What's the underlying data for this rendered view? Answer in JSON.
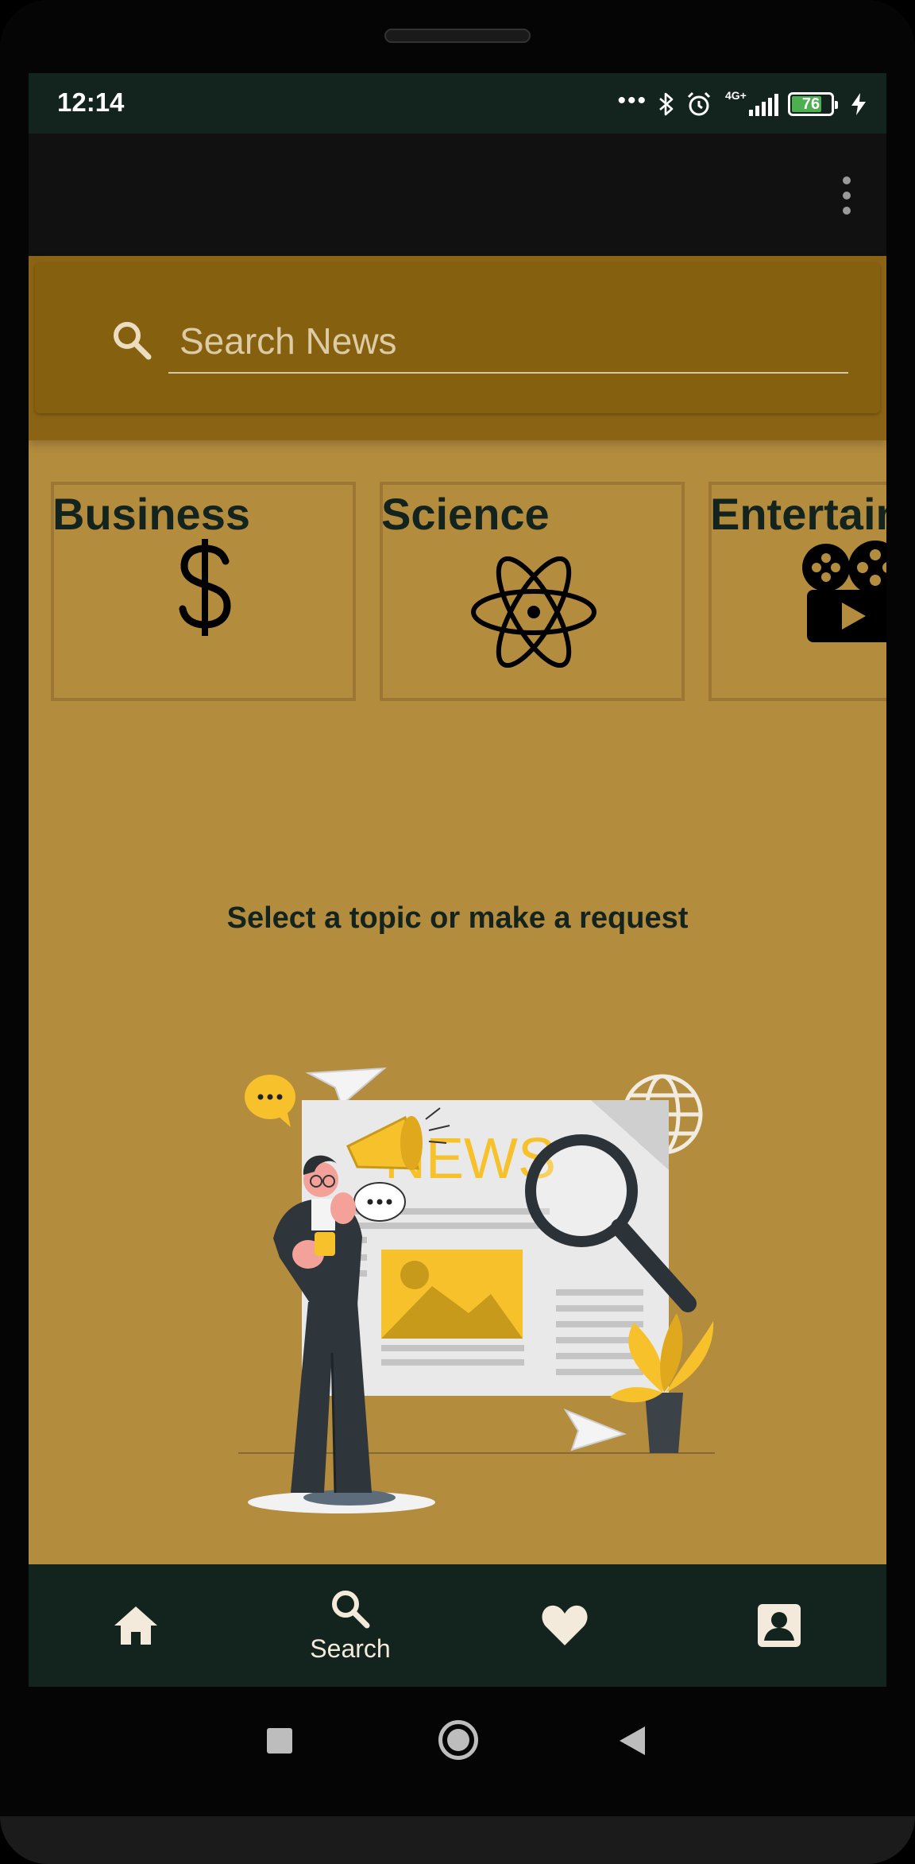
{
  "status_bar": {
    "time": "12:14",
    "dots": "•••",
    "bluetooth_icon": "bluetooth-icon",
    "alarm_icon": "alarm-icon",
    "network": "4G+",
    "battery_level": "76",
    "charging_icon": "bolt-icon"
  },
  "app_bar": {
    "menu_icon": "more-vert-icon"
  },
  "search": {
    "placeholder": "Search News",
    "value": ""
  },
  "categories": [
    {
      "label": "Business",
      "icon": "dollar-icon"
    },
    {
      "label": "Science",
      "icon": "atom-icon"
    },
    {
      "label": "Entertainment",
      "icon": "film-projector-icon"
    }
  ],
  "main": {
    "prompt": "Select a topic or make a request",
    "illustration_text": "NEWS"
  },
  "bottom_nav": {
    "items": [
      {
        "icon": "home-icon",
        "label": ""
      },
      {
        "icon": "search-icon",
        "label": "Search"
      },
      {
        "icon": "heart-icon",
        "label": ""
      },
      {
        "icon": "account-icon",
        "label": ""
      }
    ],
    "selected": "Search"
  },
  "colors": {
    "background": "#b48c3e",
    "search_bar": "#8b6315",
    "dark": "#13231e",
    "app_bar": "#111111",
    "accent_yellow": "#f6c12a"
  }
}
